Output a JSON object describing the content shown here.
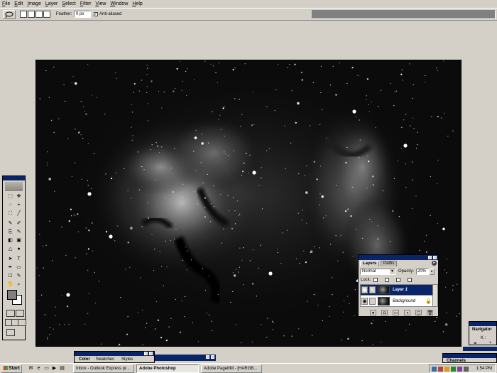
{
  "menu": [
    "File",
    "Edit",
    "Image",
    "Layer",
    "Select",
    "Filter",
    "View",
    "Window",
    "Help"
  ],
  "options_bar": {
    "feather_label": "Feather:",
    "feather_value": "0 px",
    "anti_aliased_label": "Anti-aliased",
    "anti_aliased_checked": true
  },
  "toolbox": {
    "tools": [
      "⬚",
      "✥",
      "◌",
      "⌖",
      "⛶",
      "╱",
      "✎",
      "✐",
      "⎘",
      "✎",
      "◧",
      "▣",
      "△",
      "●",
      "➤",
      "T",
      "✒",
      "▭",
      "☐",
      "✎",
      "✋",
      "⌕"
    ]
  },
  "layers_palette": {
    "tabs": [
      "Layers",
      "Paths"
    ],
    "blend_mode": "Normal",
    "opacity_label": "Opacity:",
    "opacity_value": "20%",
    "lock_label": "Lock:",
    "layers": [
      {
        "name": "Layer 1",
        "selected": true
      },
      {
        "name": "Background",
        "selected": false
      }
    ],
    "bottom_icons": [
      "●",
      "◘",
      "▭",
      "◑",
      "▢",
      "🗑"
    ]
  },
  "navigator_palette": {
    "tab": "Navigator",
    "readout": "K :"
  },
  "channels_palette": {
    "tab": "Channels"
  },
  "color_palette": {
    "tabs": [
      "Color",
      "Swatches",
      "Styles"
    ]
  },
  "taskbar": {
    "start_label": "Start",
    "tasks": [
      {
        "label": "Inbox - Outlook Express pr...",
        "active": false
      },
      {
        "label": "Adobe Photoshop",
        "active": true
      },
      {
        "label": "Adobe PageMill - [HARGB...",
        "active": false
      }
    ],
    "clock": "1:54 PM"
  },
  "colors": {
    "chrome": "#d4d0c8",
    "title_bar": "#0a246a",
    "workspace": "#d4d0c8"
  }
}
